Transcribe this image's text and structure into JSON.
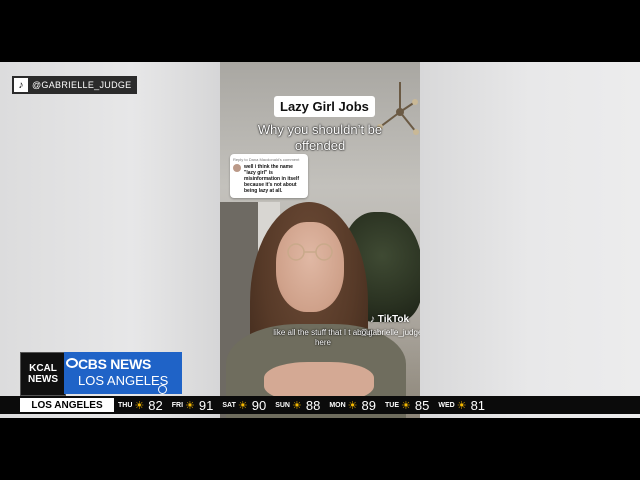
{
  "handle": {
    "icon": "tiktok-icon",
    "text": "@GABRIELLE_JUDGE"
  },
  "video": {
    "title": "Lazy Girl Jobs",
    "subtitle": "Why you shouldn’t be offended",
    "reply_header": "Reply to Dana Macdonald's comment",
    "reply_text": "well i think the name \"lazy girl\" is misinformation in itself because it's not about being lazy at all.",
    "watermark": "TikTok",
    "watermark_user": "@gabrielle_judge",
    "caption": "like all the stuff that I t about here"
  },
  "brand": {
    "kcal_line1": "KCAL",
    "kcal_line2": "NEWS",
    "cbs_line1": "CBS NEWS",
    "cbs_line2": "LOS ANGELES",
    "accent": "#1f63c7"
  },
  "ticker": {
    "city": "LOS ANGELES",
    "days": [
      {
        "day": "THU",
        "temp": "82",
        "icon": "sun-icon"
      },
      {
        "day": "FRI",
        "temp": "91",
        "icon": "sun-icon"
      },
      {
        "day": "SAT",
        "temp": "90",
        "icon": "sun-icon"
      },
      {
        "day": "SUN",
        "temp": "88",
        "icon": "sun-icon"
      },
      {
        "day": "MON",
        "temp": "89",
        "icon": "sun-icon"
      },
      {
        "day": "TUE",
        "temp": "85",
        "icon": "sun-icon"
      },
      {
        "day": "WED",
        "temp": "81",
        "icon": "sun-icon"
      }
    ]
  }
}
